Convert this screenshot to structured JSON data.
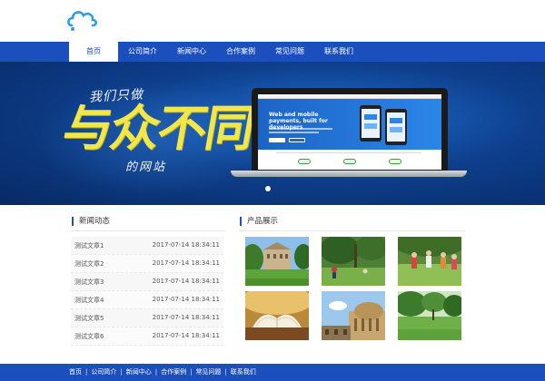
{
  "logo": {
    "icon": "cloud-logo-icon",
    "color": "#2b9be8"
  },
  "nav": {
    "items": [
      {
        "label": "首页",
        "active": true
      },
      {
        "label": "公司简介",
        "active": false
      },
      {
        "label": "新闻中心",
        "active": false
      },
      {
        "label": "合作案例",
        "active": false
      },
      {
        "label": "常见问题",
        "active": false
      },
      {
        "label": "联系我们",
        "active": false
      }
    ]
  },
  "banner": {
    "slogan_top": "我们只做",
    "slogan_big": "与众不同",
    "slogan_bottom": "的网站",
    "screen_headline": "Web and mobile payments, built for developers",
    "slide_index": 1
  },
  "news": {
    "title": "新闻动态",
    "items": [
      {
        "name": "测试文章1",
        "date": "2017-07-14 18:34:11"
      },
      {
        "name": "测试文章2",
        "date": "2017-07-14 18:34:11"
      },
      {
        "name": "测试文章3",
        "date": "2017-07-14 18:34:11"
      },
      {
        "name": "测试文章4",
        "date": "2017-07-14 18:34:11"
      },
      {
        "name": "测试文章5",
        "date": "2017-07-14 18:34:11"
      },
      {
        "name": "测试文章6",
        "date": "2017-07-14 18:34:11"
      }
    ]
  },
  "products": {
    "title": "产品展示",
    "photos": [
      "campus-building",
      "campus-lawn",
      "students-walking",
      "open-book",
      "dome-building",
      "green-park"
    ]
  },
  "footer": {
    "links": [
      "首页",
      "公司简介",
      "新闻中心",
      "合作案例",
      "常见问题",
      "联系我们"
    ]
  },
  "colors": {
    "brand_blue": "#1b4fbe",
    "slogan_yellow": "#f1e64a"
  }
}
